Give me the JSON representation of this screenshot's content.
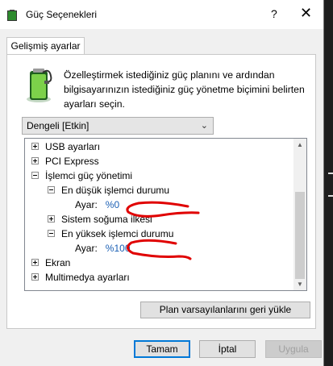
{
  "window": {
    "title": "Güç Seçenekleri",
    "help_glyph": "?",
    "close_glyph": "✕"
  },
  "tab": {
    "label": "Gelişmiş ayarlar"
  },
  "description": "Özelleştirmek istediğiniz güç planını ve ardından bilgisayarınızın istediğiniz güç yönetme biçimini belirten ayarları seçin.",
  "plan_select": {
    "value": "Dengeli [Etkin]"
  },
  "tree": {
    "usb": "USB ayarları",
    "pci": "PCI Express",
    "cpu": "İşlemci güç yönetimi",
    "min_state": "En düşük işlemci durumu",
    "min_setting_label": "Ayar:",
    "min_setting_value": "%0",
    "cooling": "Sistem soğuma ilkesi",
    "max_state": "En yüksek işlemci durumu",
    "max_setting_label": "Ayar:",
    "max_setting_value": "%100",
    "display": "Ekran",
    "multimedia": "Multimedya ayarları"
  },
  "buttons": {
    "restore": "Plan varsayılanlarını geri yükle",
    "ok": "Tamam",
    "cancel": "İptal",
    "apply": "Uygula"
  },
  "icons": {
    "app": "battery-icon",
    "plan": "battery-charge-icon",
    "expand": "plus-icon",
    "collapse": "minus-icon"
  },
  "colors": {
    "link": "#1a5fb4",
    "annotation": "#e00000",
    "default_button_border": "#0078d7"
  }
}
